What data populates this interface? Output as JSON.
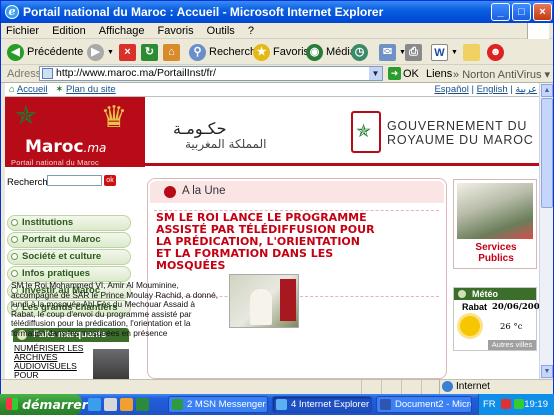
{
  "window": {
    "title": "Portail national du Maroc : Accueil - Microsoft Internet Explorer"
  },
  "menubar": {
    "items": [
      "Fichier",
      "Edition",
      "Affichage",
      "Favoris",
      "Outils",
      "?"
    ]
  },
  "toolbar": {
    "back_label": "Précédente",
    "search_label": "Rechercher",
    "favorites_label": "Favoris",
    "media_label": "Média"
  },
  "addressbar": {
    "label": "Adresse",
    "url": "http://www.maroc.ma/PortailInst/fr/",
    "go_label": "OK",
    "links_label": "Liens",
    "norton_label": "Norton AntiVirus"
  },
  "site": {
    "topnav": {
      "home": "Accueil",
      "sitemap": "Plan du site",
      "lang_es": "Español",
      "lang_en": "English",
      "lang_ar": "عربية"
    },
    "brand": {
      "name": "Maroc",
      "tld": ".ma",
      "subtitle": "Portail national du Maroc"
    },
    "header": {
      "arabic_line1": "حكـومـة",
      "arabic_line2": "المملكة المغربية",
      "gov_line1": "GOUVERNEMENT DU",
      "gov_line2": "ROYAUME DU MAROC"
    },
    "search": {
      "label": "Recherche",
      "go": "ok"
    },
    "left_menu": [
      "Institutions",
      "Portrait du Maroc",
      "Société et culture",
      "Infos pratiques",
      "Investir au Maroc",
      "Les grands chantiers"
    ],
    "faits": {
      "title": "Faits marquants",
      "text_line1": "NUMÉRISER LES",
      "text_line2": "ARCHIVES",
      "text_line3": "AUDIOVISUELS POUR"
    },
    "une": {
      "title": "A la Une",
      "headline": "SM LE ROI LANCE LE PROGRAMME ASSISTÉ PAR TÉLÉDIFFUSION POUR LA PRÉDICATION, L'ORIENTATION ET LA FORMATION DANS LES MOSQUÉES",
      "article": "SM le Roi Mohammed VI, Amir Al Mouminine, accompagné de SAR le Prince Moulay Rachid, a donné, lundi à la mosquée Ahl Fès du Mechouar Assaid à Rabat, le coup d'envoi du programme assisté par télédiffusion pour la prédication, l'orientation et la formation dans les mosquées en présence"
    },
    "services": {
      "label": "Services Publics"
    },
    "meteo": {
      "title": "Météo",
      "city": "Rabat",
      "date": "20/06/2006",
      "temp": "26 °c",
      "other": "Autres villes"
    }
  },
  "statusbar": {
    "zone": "Internet"
  },
  "taskbar": {
    "start": "démarrer",
    "tasks": [
      "2 MSN Messenger",
      "4 Internet Explorer",
      "Document2 - Micros..."
    ],
    "lang": "FR",
    "clock": "19:19"
  }
}
